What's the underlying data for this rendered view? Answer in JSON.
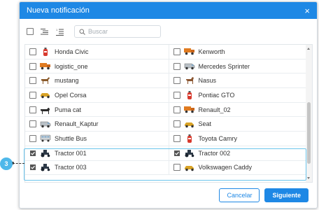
{
  "dialog": {
    "title": "Nueva notificación",
    "close_symbol": "×"
  },
  "toolbar": {
    "search_placeholder": "Buscar",
    "icons": [
      "select-all-checkbox",
      "list-icon",
      "numbered-list-icon",
      "search-icon"
    ]
  },
  "units": [
    {
      "left": {
        "name": "Honda Civic",
        "icon": "fire-extinguisher-icon",
        "checked": false
      },
      "right": {
        "name": "Kenworth",
        "icon": "truck-icon",
        "checked": false
      }
    },
    {
      "left": {
        "name": "logistic_one",
        "icon": "truck-icon",
        "checked": false
      },
      "right": {
        "name": "Mercedes Sprinter",
        "icon": "van-icon",
        "checked": false
      }
    },
    {
      "left": {
        "name": "mustang",
        "icon": "horse-icon",
        "checked": false
      },
      "right": {
        "name": "Nasus",
        "icon": "dog-icon",
        "checked": false
      }
    },
    {
      "left": {
        "name": "Opel Corsa",
        "icon": "car-icon",
        "checked": false
      },
      "right": {
        "name": "Pontiac GTO",
        "icon": "fire-extinguisher-icon",
        "checked": false
      }
    },
    {
      "left": {
        "name": "Puma cat",
        "icon": "cat-icon",
        "checked": false
      },
      "right": {
        "name": "Renault_02",
        "icon": "truck-icon",
        "checked": false
      }
    },
    {
      "left": {
        "name": "Renault_Kaptur",
        "icon": "van-icon",
        "checked": false
      },
      "right": {
        "name": "Seat",
        "icon": "car-icon",
        "checked": false
      }
    },
    {
      "left": {
        "name": "Shuttle Bus",
        "icon": "bus-icon",
        "checked": false
      },
      "right": {
        "name": "Toyota Camry",
        "icon": "fire-extinguisher-icon",
        "checked": false
      }
    },
    {
      "left": {
        "name": "Tractor 001",
        "icon": "tractor-icon",
        "checked": true
      },
      "right": {
        "name": "Tractor 002",
        "icon": "tractor-icon",
        "checked": true
      }
    },
    {
      "left": {
        "name": "Tractor 003",
        "icon": "tractor-icon",
        "checked": true
      },
      "right": {
        "name": "Volkswagen Caddy",
        "icon": "car-icon",
        "checked": false
      }
    }
  ],
  "callout": {
    "number": "3"
  },
  "footer": {
    "cancel_label": "Cancelar",
    "next_label": "Siguiente"
  },
  "colors": {
    "accent": "#1e88e5",
    "highlight": "#6cc5ec",
    "callout": "#4fb8ea"
  }
}
